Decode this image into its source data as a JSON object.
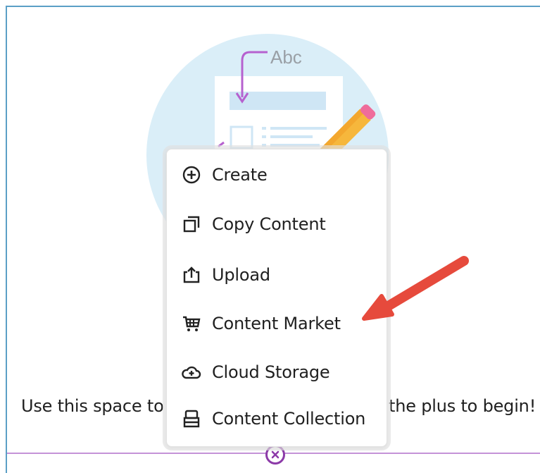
{
  "illustration": {
    "sample_text": "Abc"
  },
  "hint": {
    "left_text": "Use this space to",
    "right_text": "the plus to begin!"
  },
  "menu": {
    "items": [
      {
        "label": "Create",
        "icon": "plus-circle-icon"
      },
      {
        "label": "Copy Content",
        "icon": "copy-icon"
      },
      {
        "label": "Upload",
        "icon": "upload-icon"
      },
      {
        "label": "Content Market",
        "icon": "shopping-cart-icon"
      },
      {
        "label": "Cloud Storage",
        "icon": "cloud-add-icon"
      },
      {
        "label": "Content Collection",
        "icon": "archive-box-icon"
      }
    ]
  },
  "colors": {
    "accent_purple": "#8c3aa8",
    "annotation_arrow": "#e64a3c",
    "frame_border": "#5b9fc6"
  }
}
